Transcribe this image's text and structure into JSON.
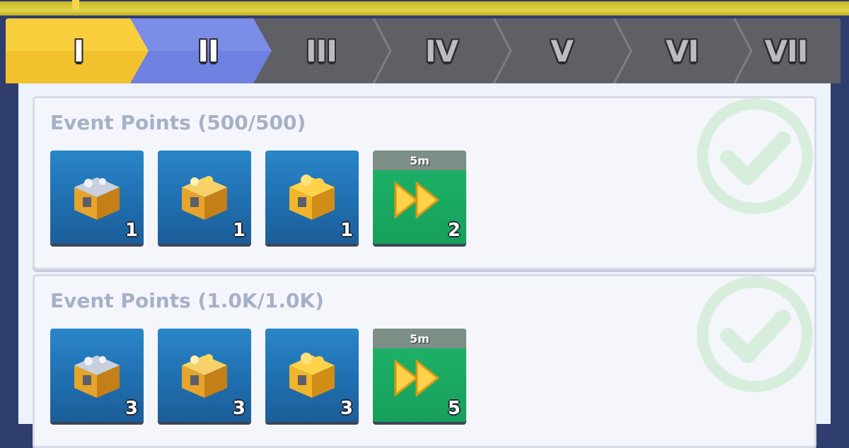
{
  "tabs": [
    {
      "label": "I",
      "state": "active"
    },
    {
      "label": "II",
      "state": "selected"
    },
    {
      "label": "III",
      "state": "default"
    },
    {
      "label": "IV",
      "state": "default"
    },
    {
      "label": "V",
      "state": "default"
    },
    {
      "label": "VI",
      "state": "default"
    },
    {
      "label": "VII",
      "state": "default"
    }
  ],
  "colors": {
    "tab_active": "#f2c12e",
    "tab_selected": "#6e80e0",
    "tab_default": "#5f6066",
    "check": "#d7eedd",
    "item_blue": "#1f6fb0",
    "item_green": "#17a05b"
  },
  "milestones": [
    {
      "title": "Event Points (500/500)",
      "completed": true,
      "rewards": [
        {
          "icon": "silver-chest-icon",
          "qty": "1"
        },
        {
          "icon": "gold-chest-icon",
          "qty": "1"
        },
        {
          "icon": "gold-ore-chest-icon",
          "qty": "1"
        },
        {
          "icon": "speedup-icon",
          "tag": "5m",
          "qty": "2"
        }
      ]
    },
    {
      "title": "Event Points (1.0K/1.0K)",
      "completed": true,
      "rewards": [
        {
          "icon": "silver-chest-icon",
          "qty": "3"
        },
        {
          "icon": "gold-chest-icon",
          "qty": "3"
        },
        {
          "icon": "gold-ore-chest-icon",
          "qty": "3"
        },
        {
          "icon": "speedup-icon",
          "tag": "5m",
          "qty": "5"
        }
      ]
    }
  ]
}
